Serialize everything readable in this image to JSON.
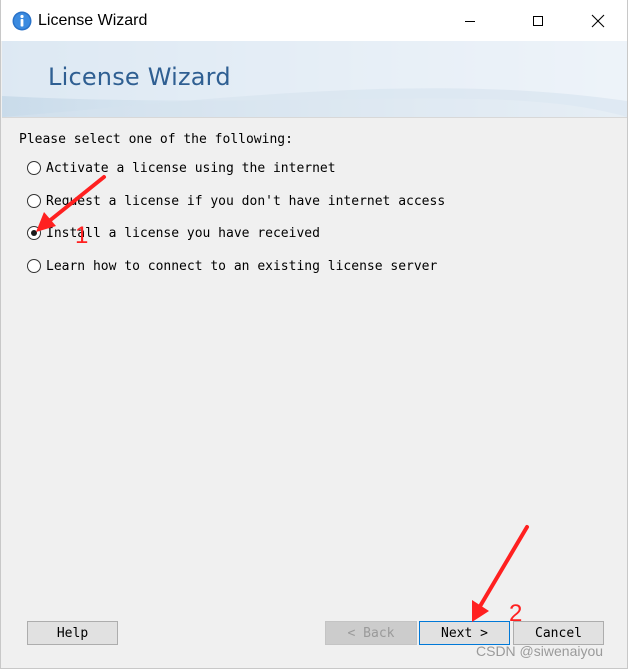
{
  "window": {
    "title": "License Wizard",
    "icon": "info-icon"
  },
  "banner": {
    "title": "License Wizard"
  },
  "prompt": "Please select one of the following:",
  "options": [
    {
      "label": "Activate a license using the internet",
      "checked": false
    },
    {
      "label": "Request a license if you don't have internet access",
      "checked": false
    },
    {
      "label": "Install a license you have received",
      "checked": true
    },
    {
      "label": "Learn how to connect to an existing license server",
      "checked": false
    }
  ],
  "buttons": {
    "help": "Help",
    "back": "< Back",
    "next": "Next >",
    "cancel": "Cancel"
  },
  "annotations": {
    "step1": "1",
    "step2": "2"
  },
  "watermark": "CSDN @siwenaiyou",
  "colors": {
    "accent": "#0078d7",
    "annotation": "#ff2020",
    "banner_text": "#2f5f92"
  }
}
